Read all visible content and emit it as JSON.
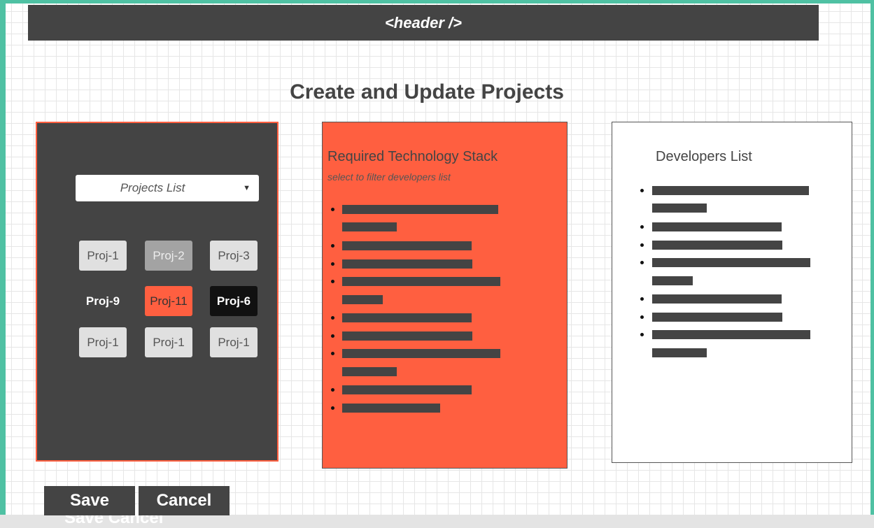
{
  "header": {
    "label": "<header />"
  },
  "page": {
    "title": "Create and Update Projects"
  },
  "projects_panel": {
    "dropdown": {
      "label": "Projects List",
      "caret_icon": "triangle-down-icon"
    },
    "projects": [
      {
        "label": "Proj-1",
        "style": "default"
      },
      {
        "label": "Proj-2",
        "style": "gray"
      },
      {
        "label": "Proj-3",
        "style": "default"
      },
      {
        "label": "Proj-9",
        "style": "plain"
      },
      {
        "label": "Proj-11",
        "style": "orange"
      },
      {
        "label": "Proj-6",
        "style": "black"
      },
      {
        "label": "Proj-1",
        "style": "default"
      },
      {
        "label": "Proj-1",
        "style": "default"
      },
      {
        "label": "Proj-1",
        "style": "default"
      }
    ]
  },
  "tech_panel": {
    "title": "Required Technology Stack",
    "subtitle": "select to filter developers list"
  },
  "devs_panel": {
    "title": "Developers List"
  },
  "actions": {
    "save_label": "Save",
    "cancel_label": "Cancel",
    "ghost_label": "Save Cancel"
  },
  "colors": {
    "frame": "#4fc1a3",
    "dark": "#444444",
    "accent": "#ff5f40"
  }
}
